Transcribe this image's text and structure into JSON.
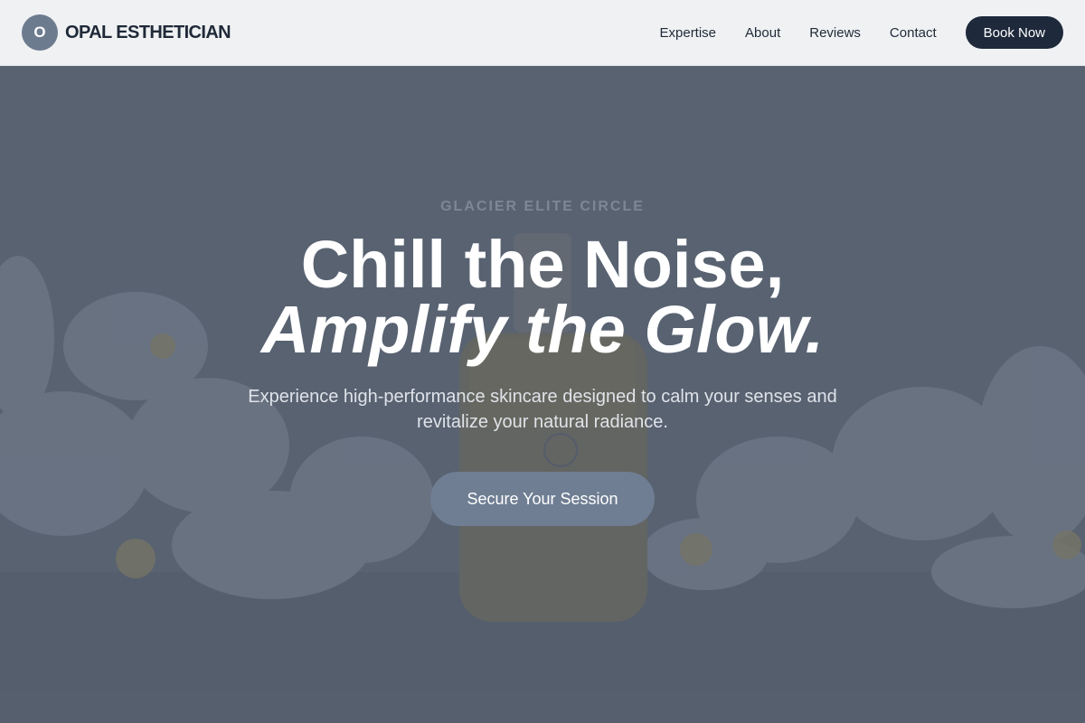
{
  "brand": {
    "logo_letter": "O",
    "name": "OPAL ESTHETICIAN"
  },
  "nav": {
    "links": [
      "Expertise",
      "About",
      "Reviews",
      "Contact"
    ],
    "cta_label": "Book Now"
  },
  "hero": {
    "eyebrow": "GLACIER ELITE CIRCLE",
    "headline_line1": "Chill the Noise,",
    "headline_line2": "Amplify the Glow.",
    "subtext": "Experience high-performance skincare designed to calm your senses and revitalize your natural radiance.",
    "cta_label": "Secure Your Session",
    "background_image": "serum bottle surrounded by white orchids"
  },
  "colors": {
    "header_bg": "#eff1f3",
    "logo_bg": "#6d7b8f",
    "brand_text": "#1f2937",
    "book_button_bg": "#1e293b",
    "cta_button_bg": "#6f7e93",
    "hero_overlay": "#5b6472"
  }
}
